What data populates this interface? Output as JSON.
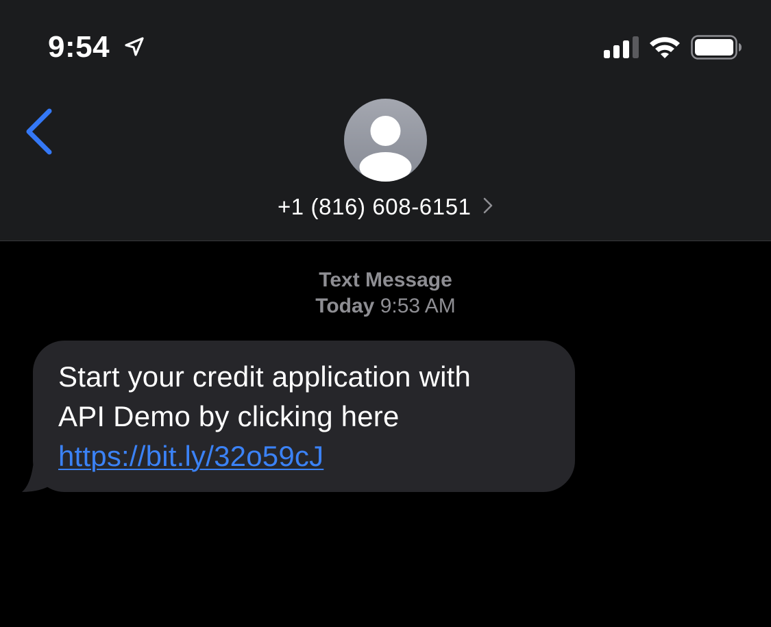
{
  "status_bar": {
    "time": "9:54",
    "location_icon": "location-arrow-icon",
    "signal_icon": "cellular-signal-icon",
    "wifi_icon": "wifi-icon",
    "battery_icon": "battery-icon"
  },
  "nav": {
    "back_icon": "chevron-left-icon",
    "avatar_icon": "person-silhouette-icon",
    "contact": "+1 (816) 608-6151",
    "contact_chevron_icon": "chevron-right-icon"
  },
  "conversation": {
    "service_label": "Text Message",
    "day": "Today",
    "time": "9:53 AM",
    "messages": [
      {
        "direction": "incoming",
        "line1": "Start your credit application with",
        "line2": "API Demo by clicking here",
        "link": "https://bit.ly/32o59cJ"
      }
    ]
  },
  "colors": {
    "background": "#000000",
    "header_background": "#1b1c1e",
    "bubble": "#26262a",
    "accent_blue": "#3b82f6",
    "secondary_text": "#8e8e93"
  }
}
